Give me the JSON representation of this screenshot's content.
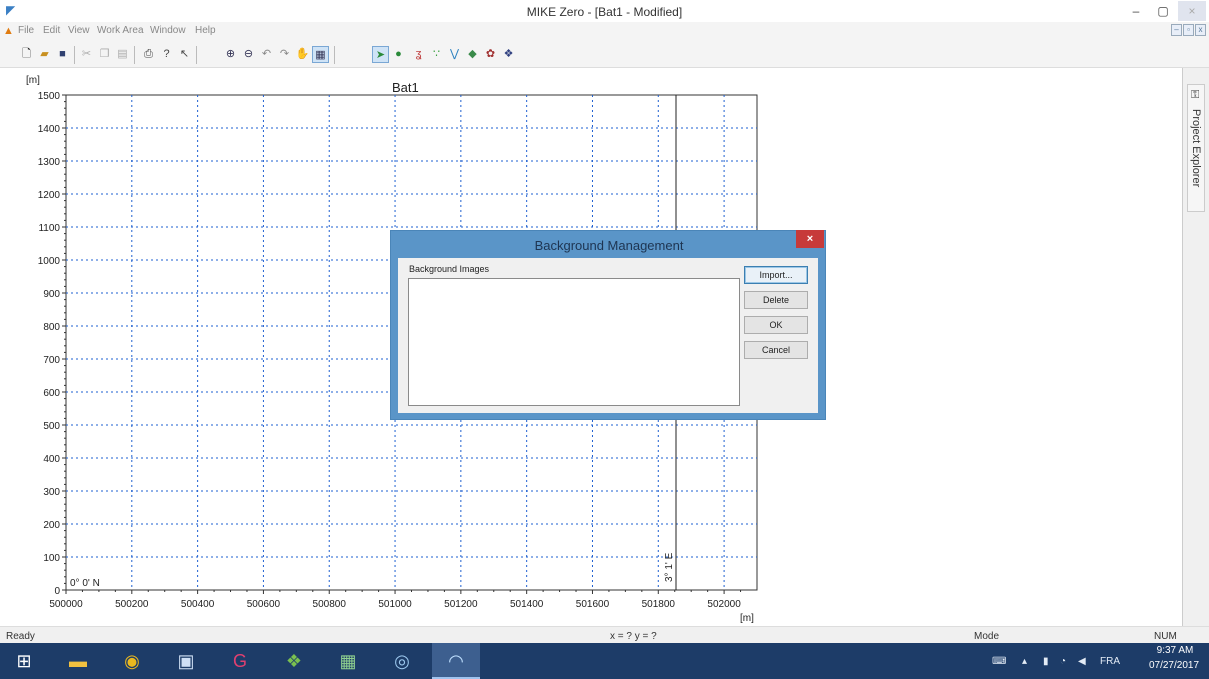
{
  "window": {
    "title": "MIKE Zero - [Bat1 - Modified]",
    "minimize": "–",
    "maximize": "▢",
    "close": "×"
  },
  "menu": {
    "items": [
      "File",
      "Edit",
      "View",
      "Work Area",
      "Window",
      "Help"
    ],
    "mdi_min": "–",
    "mdi_restore": "▫",
    "mdi_close": "x"
  },
  "chart": {
    "title": "Bat1",
    "y_unit": "[m]",
    "x_unit": "[m]",
    "y_ticks": [
      "1500",
      "1400",
      "1300",
      "1200",
      "1100",
      "1000",
      "900",
      "800",
      "700",
      "600",
      "500",
      "400",
      "300",
      "200",
      "100",
      "0"
    ],
    "x_ticks": [
      "500000",
      "500200",
      "500400",
      "500600",
      "500800",
      "501000",
      "501200",
      "501400",
      "501600",
      "501800",
      "502000"
    ],
    "lat_label": "0° 0' N",
    "lon_label": "3° 1' E",
    "gridline_color": "#1e5fd0"
  },
  "chart_data": {
    "type": "scatter",
    "title": "Bat1",
    "xlabel": "[m]",
    "ylabel": "[m]",
    "xlim": [
      500000,
      502100
    ],
    "ylim": [
      0,
      1500
    ],
    "x_ticks": [
      500000,
      500200,
      500400,
      500600,
      500800,
      501000,
      501200,
      501400,
      501600,
      501800,
      502000
    ],
    "y_ticks": [
      0,
      100,
      200,
      300,
      400,
      500,
      600,
      700,
      800,
      900,
      1000,
      1100,
      1200,
      1300,
      1400,
      1500
    ],
    "grid": true,
    "series": [],
    "annotations": [
      "0° 0' N",
      "3° 1' E"
    ]
  },
  "dialog": {
    "title": "Background Management",
    "close": "×",
    "list_label": "Background Images",
    "buttons": {
      "import": "Import...",
      "delete": "Delete",
      "ok": "OK",
      "cancel": "Cancel"
    }
  },
  "side_panel": {
    "label": "Project Explorer"
  },
  "status": {
    "left": "Ready",
    "coords": "x = ? y = ?",
    "mode": "Mode",
    "num": "NUM"
  },
  "taskbar": {
    "apps": [
      "windows-start",
      "file-explorer",
      "chrome",
      "word",
      "pdf-editor",
      "gis-app",
      "excel",
      "search-tool",
      "mike-zero"
    ],
    "tray_lang": "FRA",
    "time": "9:37 AM",
    "date": "07/27/2017"
  }
}
